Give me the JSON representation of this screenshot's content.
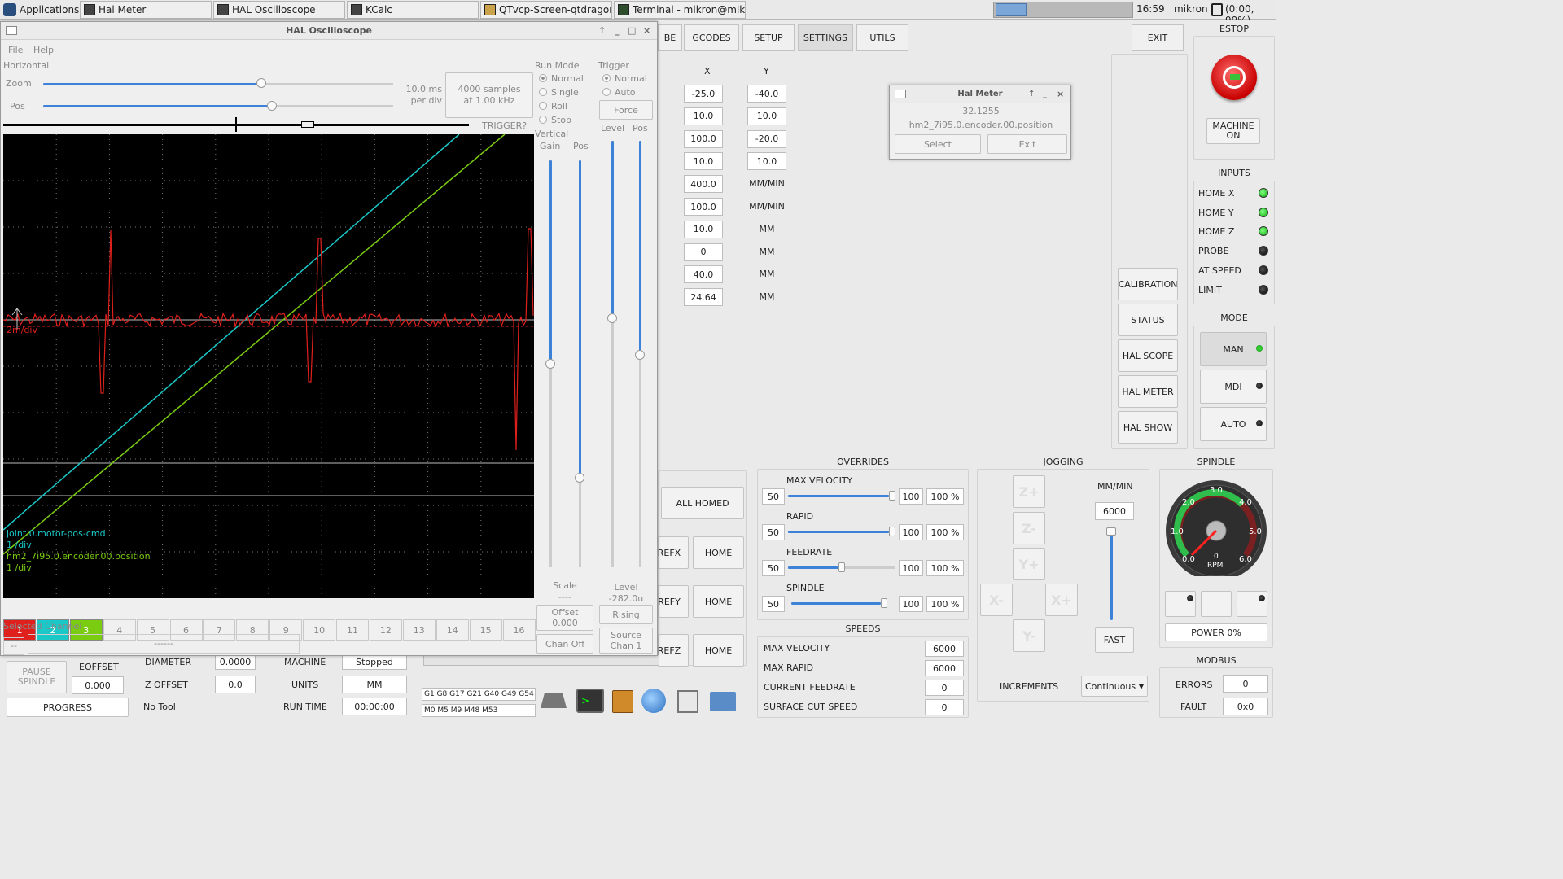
{
  "taskbar": {
    "apps_label": "Applications",
    "items": [
      "Hal Meter",
      "HAL Oscilloscope",
      "KCalc",
      "QTvcp-Screen-qtdragon...",
      "Terminal - mikron@mik..."
    ],
    "clock": "16:59",
    "user": "mikron",
    "battery": "(0:00, 99%)"
  },
  "main": {
    "nav": [
      "BE",
      "GCODES",
      "SETUP",
      "SETTINGS",
      "UTILS"
    ],
    "exit": "EXIT",
    "col_x": "X",
    "col_y": "Y",
    "x_values": [
      "-25.0",
      "10.0",
      "100.0",
      "10.0",
      "400.0",
      "100.0",
      "10.0",
      "0",
      "40.0",
      "24.64"
    ],
    "y_values": [
      "-40.0",
      "10.0",
      "-20.0",
      "10.0"
    ],
    "y_units": [
      "MM/MIN",
      "MM/MIN",
      "MM",
      "MM",
      "MM",
      "MM"
    ],
    "side_buttons": [
      "CALIBRATION",
      "STATUS",
      "HAL SCOPE",
      "HAL METER",
      "HAL SHOW"
    ],
    "estop": "ESTOP",
    "machine_on": "MACHINE\nON",
    "inputs_title": "INPUTS",
    "inputs": [
      {
        "label": "HOME X",
        "on": true
      },
      {
        "label": "HOME Y",
        "on": true
      },
      {
        "label": "HOME Z",
        "on": true
      },
      {
        "label": "PROBE",
        "on": false
      },
      {
        "label": "AT SPEED",
        "on": false
      },
      {
        "label": "LIMIT",
        "on": false
      }
    ],
    "mode_title": "MODE",
    "modes": [
      "MAN",
      "MDI",
      "AUTO"
    ],
    "overrides_title": "OVERRIDES",
    "overrides": [
      {
        "label": "MAX VELOCITY",
        "min": "50",
        "max": "100",
        "val": "100 %",
        "pct": 1.0
      },
      {
        "label": "RAPID",
        "min": "50",
        "max": "100",
        "val": "100 %",
        "pct": 1.0
      },
      {
        "label": "FEEDRATE",
        "min": "50",
        "max": "100",
        "val": "100 %",
        "pct": 0.5
      },
      {
        "label": "SPINDLE",
        "min": "50",
        "max": "100",
        "val": "100 %",
        "pct": 1.0
      }
    ],
    "speeds_title": "SPEEDS",
    "speeds": [
      {
        "label": "MAX VELOCITY",
        "val": "6000"
      },
      {
        "label": "MAX RAPID",
        "val": "6000"
      },
      {
        "label": "CURRENT FEEDRATE",
        "val": "0"
      },
      {
        "label": "SURFACE CUT SPEED",
        "val": "0"
      }
    ],
    "jogging_title": "JOGGING",
    "jog_units": "MM/MIN",
    "jog_rate": "6000",
    "fast": "FAST",
    "increments": "INCREMENTS",
    "increments_val": "Continuous",
    "jog_keys": [
      "Z+",
      "Z-",
      "Y+",
      "X-",
      "X+",
      "Y-"
    ],
    "all_homed": "ALL HOMED",
    "home": "HOME",
    "refx": "REFX",
    "refy": "REFY",
    "refz": "REFZ",
    "spindle_title": "SPINDLE",
    "gauge_labels": [
      "0.0",
      "1.0",
      "2.0",
      "3.0",
      "4.0",
      "5.0",
      "6.0"
    ],
    "gauge_zero": "0",
    "gauge_unit": "RPM",
    "power": "POWER 0%",
    "modbus_title": "MODBUS",
    "errors_label": "ERRORS",
    "errors_val": "0",
    "fault_label": "FAULT",
    "fault_val": "0x0",
    "bottom": {
      "pause": "PAUSE\nSPINDLE",
      "eoffset": "EOFFSET",
      "eoffset_val": "0.000",
      "progress": "PROGRESS",
      "diameter": "DIAMETER",
      "diameter_val": "0.0000",
      "zoffset": "Z OFFSET",
      "zoffset_val": "0.0",
      "notool": "No Tool",
      "machine": "MACHINE",
      "machine_val": "Stopped",
      "units": "UNITS",
      "units_val": "MM",
      "runtime": "RUN TIME",
      "runtime_val": "00:00:00",
      "gcodes": "G1 G8 G17 G21 G40 G49 G54",
      "mcodes": "M0 M5 M9 M48 M53"
    }
  },
  "scope": {
    "title": "HAL Oscilloscope",
    "menu": [
      "File",
      "Help"
    ],
    "horizontal": "Horizontal",
    "zoom": "Zoom",
    "pos": "Pos",
    "per_div": "10.0 ms\nper div",
    "samples": "4000 samples\nat 1.00 kHz",
    "trigger_q": "TRIGGER?",
    "run_mode": "Run Mode",
    "run_opts": [
      "Normal",
      "Single",
      "Roll",
      "Stop"
    ],
    "trigger": "Trigger",
    "trig_opts": [
      "Normal",
      "Auto"
    ],
    "force": "Force",
    "level": "Level",
    "tpos": "Pos",
    "vertical": "Vertical",
    "gain": "Gain",
    "vpos": "Pos",
    "scale": "Scale",
    "scale_val": "----",
    "offset": "Offset\n0.000",
    "chan_off": "Chan Off",
    "level_val": "Level\n-282.0u",
    "rising": "Rising",
    "source": "Source\nChan  1",
    "trace_labels": [
      "joint.0.motor-pos-cmd",
      "1 /div",
      "hm2_7i95.0.encoder.00.position",
      "1 /div"
    ],
    "ch1_label": "2m/div",
    "channels": [
      "1",
      "2",
      "3",
      "4",
      "5",
      "6",
      "7",
      "8",
      "9",
      "10",
      "11",
      "12",
      "13",
      "14",
      "15",
      "16"
    ],
    "channel_colors": [
      "#e0201c",
      "#1ac8c8",
      "#7acc10"
    ],
    "selected_channel": "Selected Channel",
    "sel_id": "--",
    "sel_name": "------"
  },
  "halmeter": {
    "title": "Hal Meter",
    "value": "32.1255",
    "pin": "hm2_7i95.0.encoder.00.position",
    "select": "Select",
    "exit": "Exit"
  }
}
